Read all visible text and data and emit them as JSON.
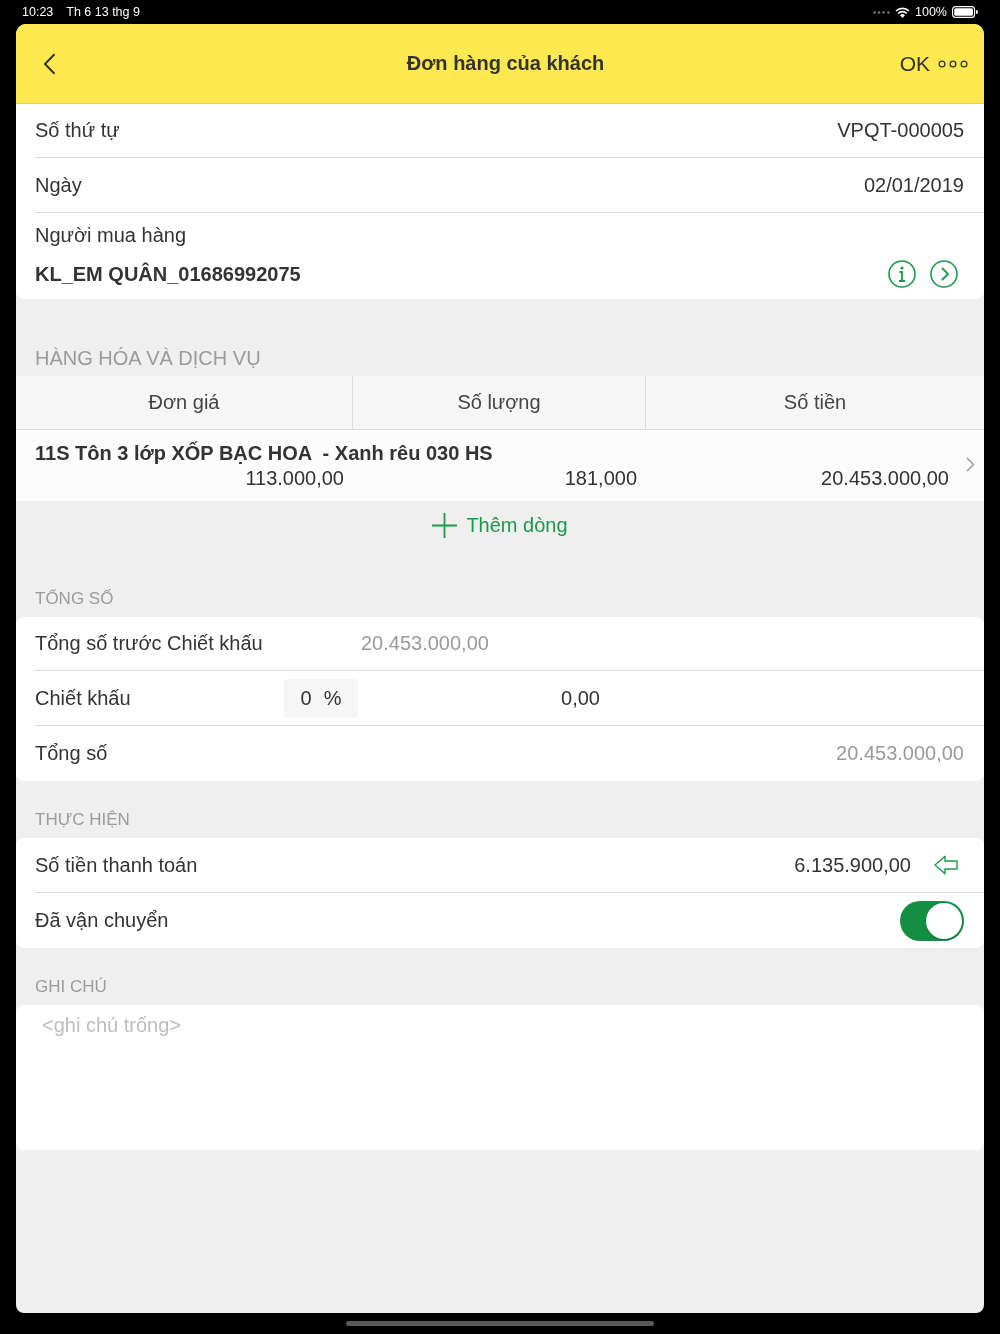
{
  "status_bar": {
    "time": "10:23",
    "date": "Th 6 13 thg 9",
    "battery": "100%"
  },
  "nav_bar": {
    "title": "Đơn hàng của khách",
    "ok_button": "OK"
  },
  "details": [
    {
      "kind": "field",
      "label": "Số thứ tự",
      "value": "VPQT-000005"
    },
    {
      "kind": "field",
      "label": "Ngày",
      "value": "02/01/2019"
    },
    {
      "kind": "customer",
      "label": "Người mua hàng",
      "value": "KL_EM QUÂN_01686992075"
    }
  ],
  "goods": {
    "header": "HÀNG HÓA VÀ DỊCH VỤ",
    "columns": [
      "Đơn giá",
      "Số lượng",
      "Số tiền"
    ],
    "rows": [
      {
        "name": "11S Tôn 3 lớp XỐP BẠC HOA  - Xanh rêu 030 HS",
        "unit_price": "113.000,00",
        "quantity": "181,000",
        "amount": "20.453.000,00"
      }
    ],
    "add_button": "Thêm dòng"
  },
  "totals": {
    "header": "TỔNG SỐ",
    "rows": [
      {
        "kind": "subtotal",
        "label": "Tổng số trước Chiết khấu",
        "value": "20.453.000,00"
      },
      {
        "kind": "discount",
        "label": "Chiết khấu",
        "percent": "0",
        "unit": "%",
        "value": "0,00"
      },
      {
        "kind": "total",
        "label": "Tổng số",
        "value": "20.453.000,00"
      }
    ]
  },
  "execution": {
    "header": "THỰC HIỆN",
    "rows": [
      {
        "kind": "payment",
        "label": "Số tiền thanh toán",
        "value": "6.135.900,00"
      },
      {
        "kind": "toggle",
        "label": "Đã vận chuyển",
        "on": true
      }
    ]
  },
  "notes": {
    "header": "GHI CHÚ",
    "placeholder": "<ghi chú trống>"
  }
}
